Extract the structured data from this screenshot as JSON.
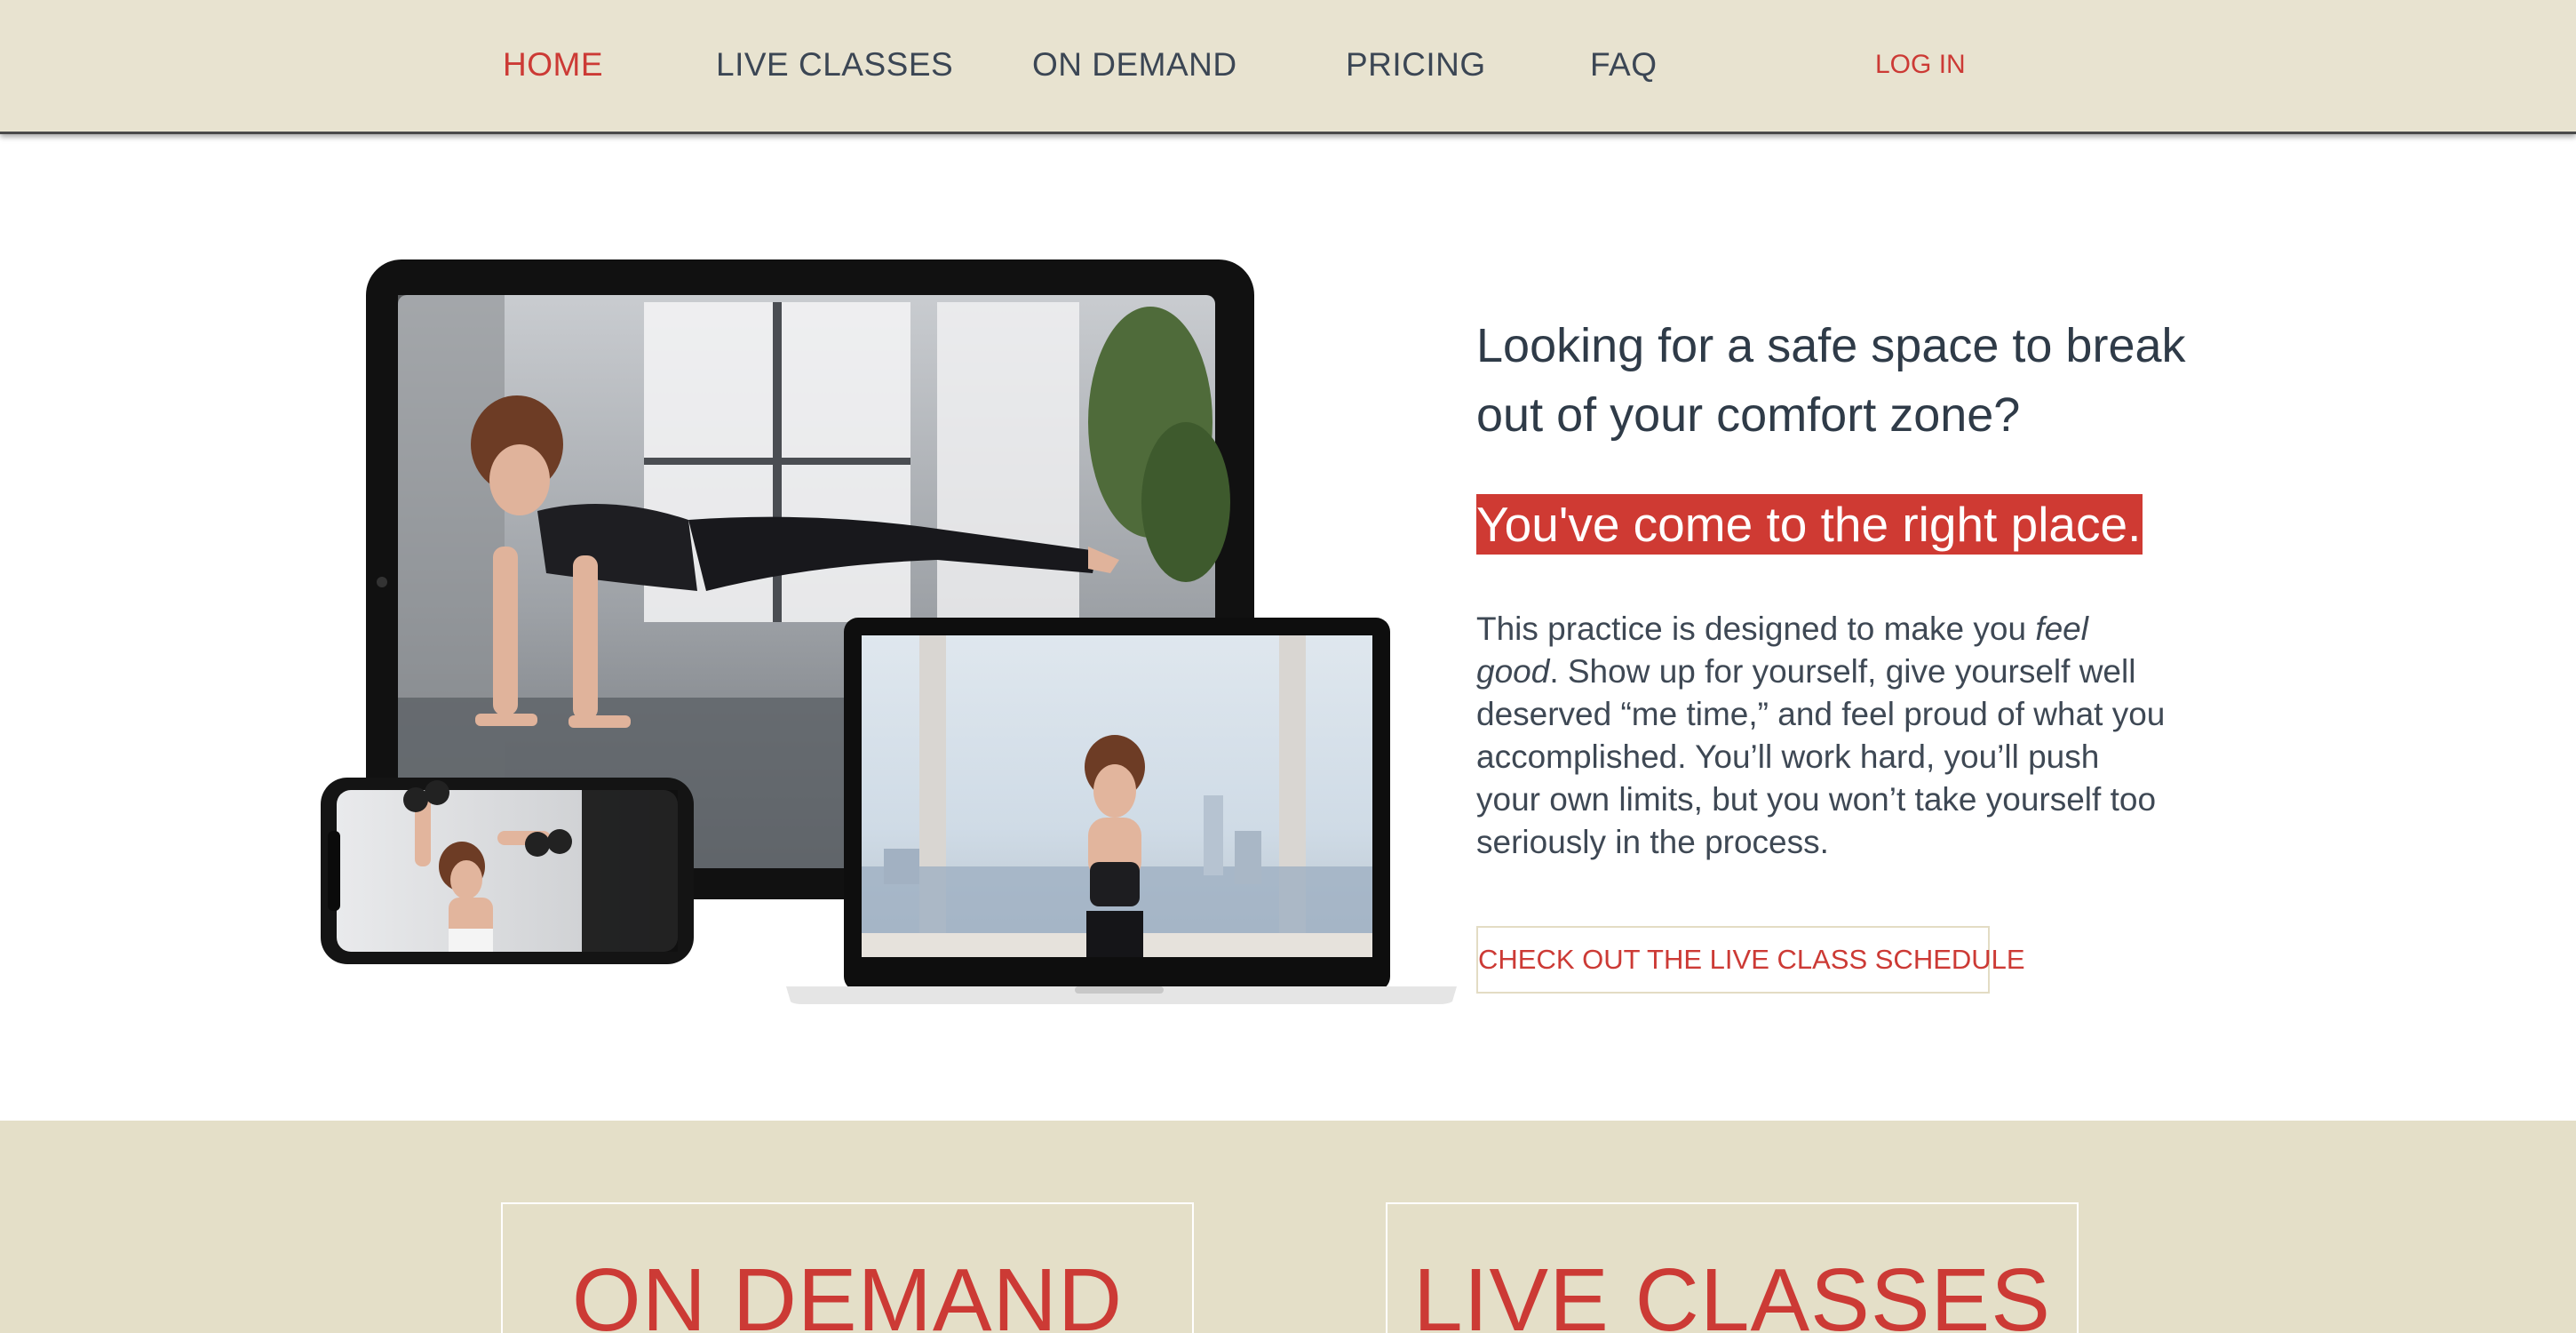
{
  "nav": {
    "items": [
      {
        "label": "HOME",
        "active": true
      },
      {
        "label": "LIVE CLASSES",
        "active": false
      },
      {
        "label": "ON DEMAND",
        "active": false
      },
      {
        "label": "PRICING",
        "active": false
      },
      {
        "label": "FAQ",
        "active": false
      }
    ],
    "login_label": "LOG IN"
  },
  "hero": {
    "headline": "Looking for a safe space to break out of your comfort zone?",
    "highlight": "You've come to the right place.",
    "body_before": "This practice is designed to make you ",
    "body_em": "feel good",
    "body_after": ". Show up for yourself, give yourself well deserved “me time,” and feel proud of what you accomplished. You’ll work hard, you’ll push your own limits, but you won’t take yourself too seriously in the process.",
    "cta_label": "CHECK OUT THE LIVE CLASS SCHEDULE",
    "image_alt": "Devices showing workout classes"
  },
  "cards": [
    {
      "title": "ON DEMAND"
    },
    {
      "title": "LIVE CLASSES"
    }
  ],
  "colors": {
    "accent": "#cc3a35",
    "nav_bg": "#e8e3d0",
    "band_bg": "#e4dfc8",
    "text": "#3b4654"
  }
}
